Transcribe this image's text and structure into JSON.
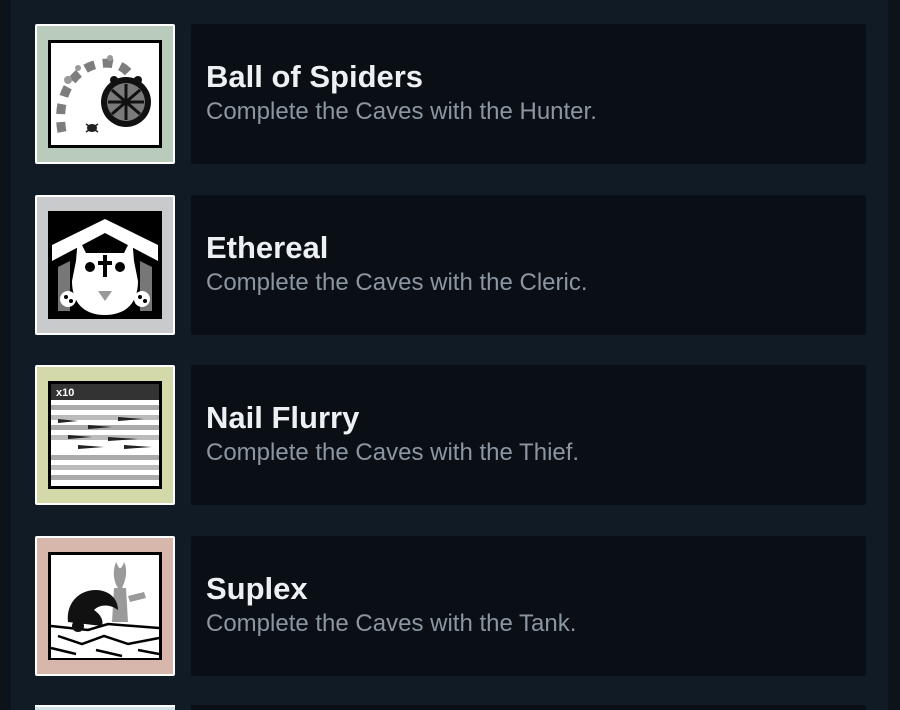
{
  "achievements": [
    {
      "title": "Ball of Spiders",
      "description": "Complete the Caves with the Hunter.",
      "icon": "ball-of-spiders-icon",
      "frame_color": "#b9ccbb"
    },
    {
      "title": "Ethereal",
      "description": "Complete the Caves with the Cleric.",
      "icon": "ethereal-icon",
      "frame_color": "#c9cacc"
    },
    {
      "title": "Nail Flurry",
      "description": "Complete the Caves with the Thief.",
      "icon": "nail-flurry-icon",
      "frame_color": "#d3d9a8",
      "badge_text": "x10"
    },
    {
      "title": "Suplex",
      "description": "Complete the Caves with the Tank.",
      "icon": "suplex-icon",
      "frame_color": "#d7b7ac"
    }
  ]
}
